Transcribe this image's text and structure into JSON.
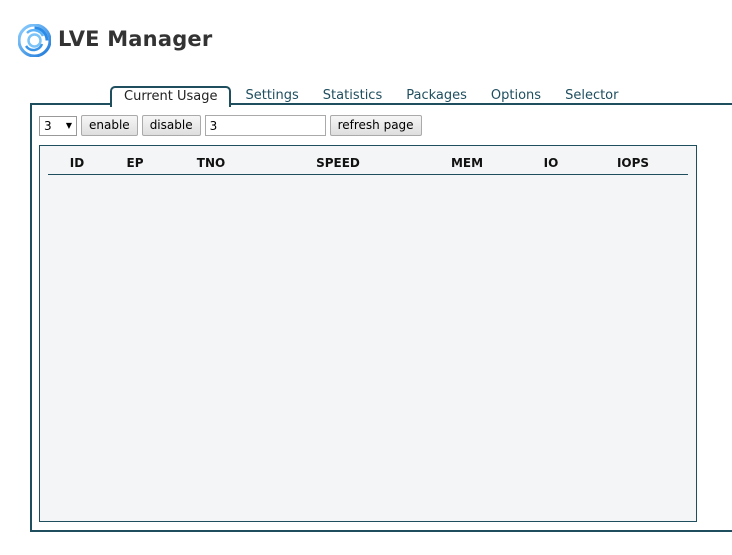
{
  "app": {
    "title": "LVE Manager",
    "logo_icon": "swirl-logo-icon"
  },
  "tabs": [
    {
      "label": "Current Usage",
      "active": true
    },
    {
      "label": "Settings"
    },
    {
      "label": "Statistics"
    },
    {
      "label": "Packages"
    },
    {
      "label": "Options"
    },
    {
      "label": "Selector"
    }
  ],
  "toolbar": {
    "refresh_select_value": "3",
    "enable_label": "enable",
    "disable_label": "disable",
    "interval_value": "3",
    "refresh_label": "refresh page"
  },
  "table": {
    "columns": [
      "ID",
      "EP",
      "TNO",
      "SPEED",
      "MEM",
      "IO",
      "IOPS"
    ],
    "rows": []
  },
  "colors": {
    "accent": "#1f4e5f",
    "grid_bg": "#f4f5f6"
  }
}
